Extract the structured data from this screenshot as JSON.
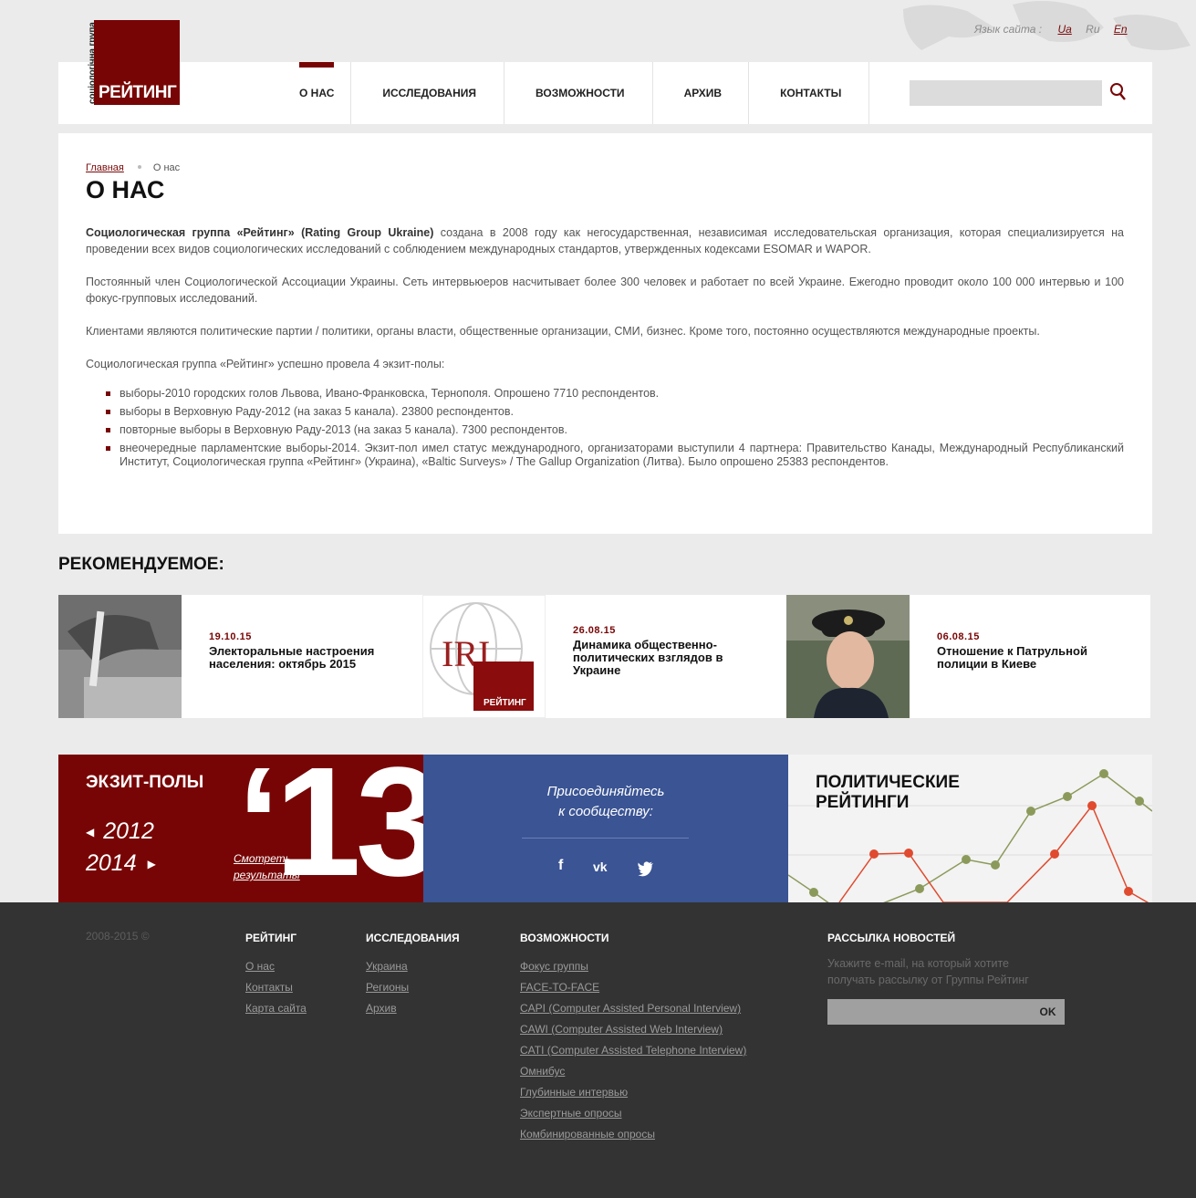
{
  "header": {
    "logo_vertical": "соціологічна група",
    "logo_brand": "РЕЙТИНГ",
    "lang_label": "Язык сайта :",
    "langs": [
      "Ua",
      "Ru",
      "En"
    ],
    "nav": [
      "О НАС",
      "ИССЛЕДОВАНИЯ",
      "ВОЗМОЖНОСТИ",
      "АРХИВ",
      "КОНТАКТЫ"
    ],
    "search_placeholder": ""
  },
  "breadcrumb": {
    "home": "Главная",
    "current": "О нас"
  },
  "page_title": "О НАС",
  "content": {
    "p1_bold": "Социологическая группа «Рейтинг» (Rating Group Ukraine)",
    "p1_rest": " создана в 2008 году как негосударственная, независимая исследовательская организация, которая специализируется на проведении всех видов социологических исследований с соблюдением международных стандартов, утвержденных кодексами ESOMAR и WAPOR.",
    "p2": "Постоянный член Социологической Ассоциации Украины. Сеть интервьюеров насчитывает более 300 человек и работает по всей Украине. Ежегодно проводит около 100 000 интервью и 100 фокус-групповых исследований.",
    "p3": "Клиентами являются политические партии / политики, органы власти, общественные организации, СМИ, бизнес. Кроме того, постоянно осуществляются международные проекты.",
    "p4": "Социологическая группа «Рейтинг» успешно провела 4 экзит-полы:",
    "list": [
      "выборы-2010 городских голов Львова, Ивано-Франковска, Тернополя. Опрошено 7710 респондентов.",
      "выборы в Верховную Раду-2012 (на заказ 5 канала). 23800 респондентов.",
      "повторные выборы в Верховную Раду-2013 (на заказ 5 канала). 7300 респондентов.",
      "внеочередные парламентские выборы-2014. Экзит-пол имел статус международного, организаторами выступили 4 партнера: Правительство Канады, Международный Республиканский Институт, Социологическая группа «Рейтинг» (Украина), «Baltic Surveys» / The Gallup Organization (Литва). Было опрошено 25383 респондентов."
    ]
  },
  "recommended": {
    "title": "РЕКОМЕНДУЕМОЕ:",
    "cards": [
      {
        "date": "19.10.15",
        "title": "Электоральные настроения населения: октябрь 2015"
      },
      {
        "date": "26.08.15",
        "title": "Динамика общественно-политических взглядов в Украине",
        "thumb_iri": "IRI",
        "thumb_brand": "РЕЙТИНГ"
      },
      {
        "date": "06.08.15",
        "title": "Отношение к Патрульной полиции в Киеве"
      }
    ]
  },
  "exit_polls": {
    "title": "ЭКЗИТ-ПОЛЫ",
    "prev_year": "2012",
    "next_year": "2014",
    "current": "‘13",
    "link": "Смотреть результаты"
  },
  "social": {
    "text": "Присоединяйтесь к сообществу:",
    "icons": [
      "facebook-icon",
      "vk-icon",
      "twitter-icon"
    ]
  },
  "political": {
    "title": "ПОЛИТИЧЕСКИЕ РЕЙТИНГИ"
  },
  "footer": {
    "copyright": "2008-2015 ©",
    "col1": {
      "title": "РЕЙТИНГ",
      "links": [
        "О нас",
        "Контакты",
        "Карта сайта"
      ]
    },
    "col2": {
      "title": "ИССЛЕДОВАНИЯ",
      "links": [
        "Украина",
        "Регионы",
        "Архив"
      ]
    },
    "col3": {
      "title": "ВОЗМОЖНОСТИ",
      "links": [
        "Фокус группы",
        "FACE-TO-FACE",
        "CAPI (Computer Assisted Personal Interview)",
        "CAWI (Computer Assisted Web Interview)",
        "CATI (Computer Assisted Telephone Interview)",
        "Омнибус",
        "Глубинные интервью",
        "Экспертные опросы",
        "Комбинированные опросы"
      ]
    },
    "newsletter": {
      "title": "РАССЫЛКА НОВОСТЕЙ",
      "text": "Укажите e-mail, на который хотите получать рассылку от Группы Рейтинг",
      "button": "OK"
    }
  },
  "colors": {
    "brand": "#780505",
    "social": "#3a5494",
    "footer": "#333333"
  }
}
